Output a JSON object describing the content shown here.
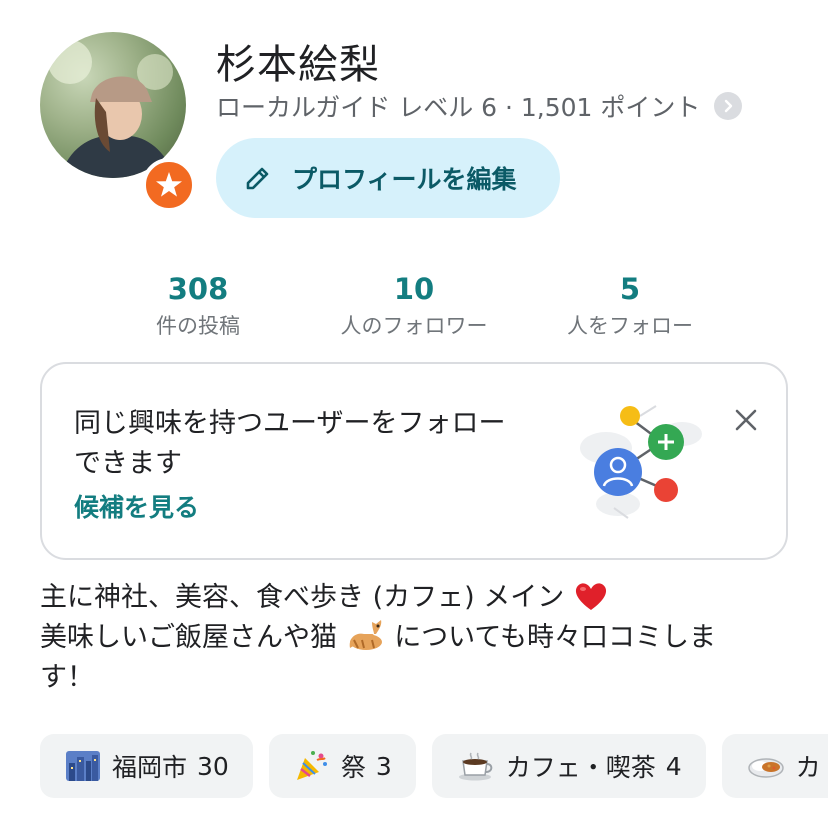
{
  "profile": {
    "name": "杉本絵梨",
    "guide_text": "ローカルガイド レベル 6 · 1,501 ポイント",
    "edit_button_label": "プロフィールを編集"
  },
  "stats": [
    {
      "value": "308",
      "label": "件の投稿"
    },
    {
      "value": "10",
      "label": "人のフォロワー"
    },
    {
      "value": "5",
      "label": "人をフォロー"
    }
  ],
  "suggestion_card": {
    "message_line1": "同じ興味を持つユーザーをフォロー",
    "message_line2": "できます",
    "link_label": "候補を見る"
  },
  "bio": {
    "line1": "主に神社、美容、食べ歩き (カフェ) メイン",
    "line1_emoji": "heart",
    "line2_before": "美味しいご飯屋さんや猫",
    "line2_emoji": "cat",
    "line2_after": "についても時々口コミしま",
    "line3": "す！"
  },
  "chips": [
    {
      "icon": "cityscape-icon",
      "label": "福岡市",
      "count": "30"
    },
    {
      "icon": "party-popper-icon",
      "label": "祭",
      "count": "3"
    },
    {
      "icon": "coffee-cup-icon",
      "label": "カフェ・喫茶",
      "count": "4"
    },
    {
      "icon": "curry-icon",
      "label": "カ",
      "count": ""
    }
  ],
  "colors": {
    "accent_teal": "#137d80",
    "edit_button_bg": "#d6f1fb",
    "badge_orange": "#f26a21",
    "chip_bg": "#f1f3f4"
  }
}
